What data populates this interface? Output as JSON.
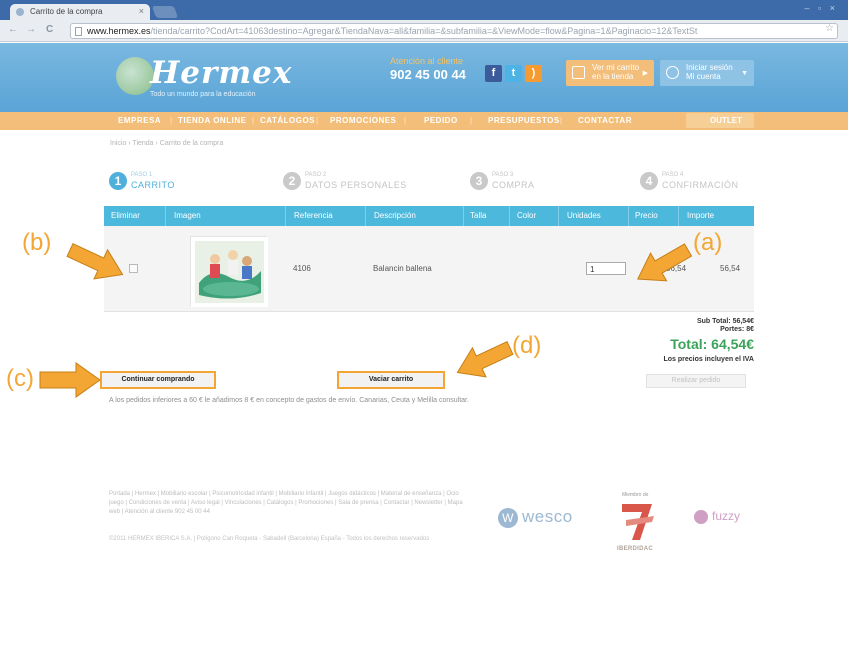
{
  "browser": {
    "tab_title": "Carrito de la compra",
    "tab_close": "×",
    "window_controls": "– ▫ ×",
    "url_host": "www.hermex.es",
    "url_path": "/tienda/carrito?CodArt=41063destino=Agregar&TiendaNava=all&familia=&subfamilia=&ViewMode=flow&Pagina=1&Paginacio=12&TextSt",
    "back": "←",
    "forward": "→",
    "reload": "C",
    "bookmark": "☆"
  },
  "header": {
    "logo": "Hermex",
    "tagline": "Todo un mundo para la educación",
    "phone_label": "Atención al cliente",
    "phone": "902 45 00 44",
    "cart_btn_line1": "Ver mi carrito",
    "cart_btn_line2": "en la tienda",
    "login_btn_line1": "Iniciar sesión",
    "login_btn_line2": "Mi cuenta"
  },
  "nav": {
    "items": [
      "EMPRESA",
      "TIENDA ONLINE",
      "CATÁLOGOS",
      "PROMOCIONES",
      "PEDIDO",
      "PRESUPUESTOS",
      "CONTACTAR"
    ],
    "outlet": "OUTLET"
  },
  "breadcrumb": "Inicio  ›  Tienda  ›  Carrito de la compra",
  "steps": [
    {
      "num": "1",
      "small": "PASO 1",
      "big": "CARRITO",
      "active": true
    },
    {
      "num": "2",
      "small": "PASO 2",
      "big": "DATOS PERSONALES",
      "active": false
    },
    {
      "num": "3",
      "small": "PASO 3",
      "big": "COMPRA",
      "active": false
    },
    {
      "num": "4",
      "small": "PASO 4",
      "big": "CONFIRMACIÓN",
      "active": false
    }
  ],
  "table": {
    "headers": [
      "Eliminar",
      "Imagen",
      "Referencia",
      "Descripción",
      "Talla",
      "Color",
      "Unidades",
      "Precio",
      "Importe"
    ],
    "rows": [
      {
        "referencia": "4106",
        "descripcion": "Balancin ballena",
        "talla": "",
        "color": "",
        "unidades": "1",
        "precio": "56,54",
        "importe": "56,54"
      }
    ]
  },
  "totals": {
    "subtotal": "Sub Total: 56,54€",
    "portes": "Portes: 8€",
    "total": "Total: 64,54€",
    "iva_note": "Los precios incluyen el IVA",
    "checkout": "Realizar pedido"
  },
  "actions": {
    "continue": "Continuar comprando",
    "empty": "Vaciar carrito"
  },
  "shipping_note": "A los pedidos inferiores a 60 € le añadimos 8 € en concepto de gastos de envío. Canarias, Ceuta y Melilla consultar.",
  "footer": {
    "links": "Portada | Hermex | Mobiliario escolar | Psicomotricidad infantil | Mobiliario infantil | Juegos didácticos | Material de enseñanza | Ocio juego | Condiciones de venta | Aviso legal | Vinculaciones | Catálogos | Promociones | Sala de prensa | Contactar | Newsletter | Mapa web | Atención al cliente 902 45 00 44",
    "copyright": "©2011 HERMEX IBERICA S.A. | Polígono Can Roqueta - Sabadell (Barcelona) España - Todos los derechos reservados",
    "member_of": "Miembro de",
    "partner1": "wesco",
    "partner2": "IBERDIDAC",
    "partner3": "fuzzy"
  },
  "annotations": {
    "a": "(a)",
    "b": "(b)",
    "c": "(c)",
    "d": "(d)"
  },
  "colors": {
    "header_blue": "#5aa4d6",
    "nav_orange": "#f3be7a",
    "table_blue": "#4cb8dc",
    "annotation_orange": "#f3a634",
    "total_green": "#3ca25a"
  }
}
